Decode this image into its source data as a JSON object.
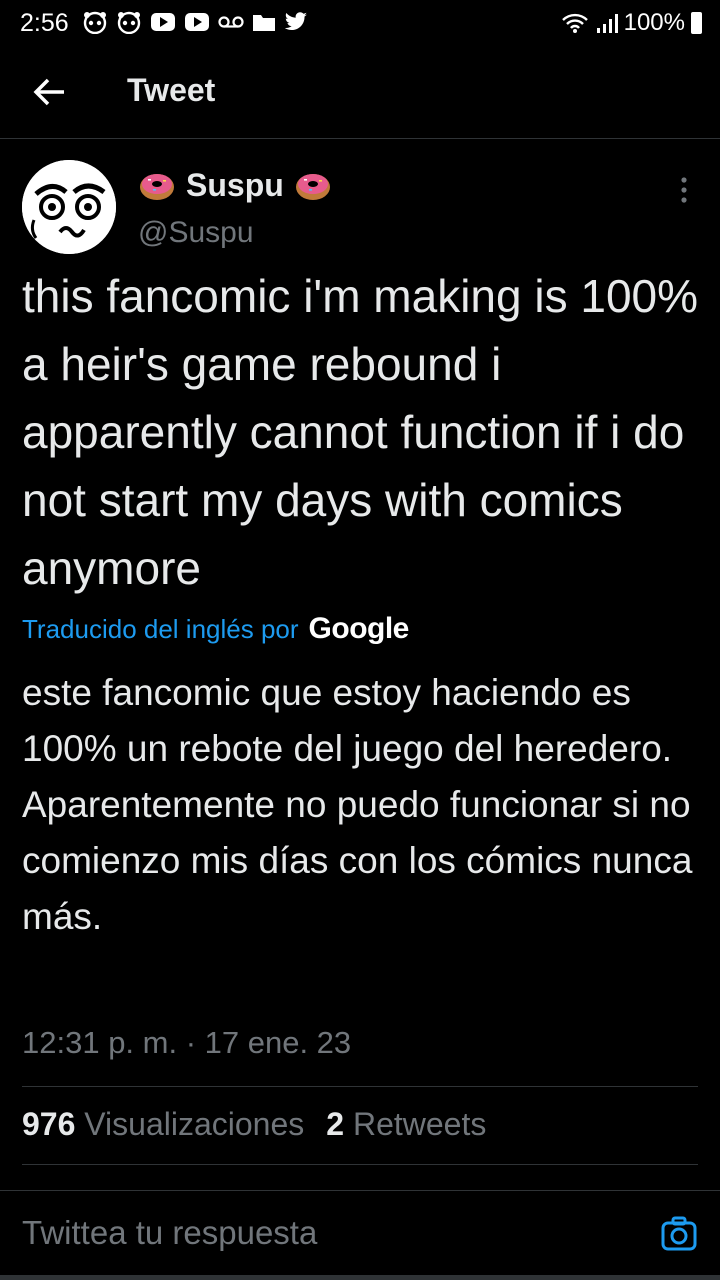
{
  "status_bar": {
    "time": "2:56",
    "battery": "100%",
    "icons": [
      "panda-icon",
      "panda-icon",
      "youtube-icon",
      "youtube-icon",
      "voicemail-icon",
      "folder-icon",
      "twitter-icon"
    ]
  },
  "header": {
    "title": "Tweet"
  },
  "tweet": {
    "display_name": "Suspu",
    "handle": "@Suspu",
    "text": "this fancomic i'm making is 100% a heir's game rebound i apparently cannot function if i do not start my days with comics anymore",
    "translated_label": "Traducido del inglés por",
    "translator": "Google",
    "translation": "este fancomic que estoy haciendo es 100% un rebote del juego del heredero. Aparentemente no puedo funcionar si no comienzo mis días con los cómics nunca más.",
    "timestamp": "12:31 p. m. · 17 ene. 23",
    "views_count": "976",
    "views_label": "Visualizaciones",
    "retweets_count": "2",
    "retweets_label": "Retweets"
  },
  "reply": {
    "placeholder": "Twittea tu respuesta"
  },
  "colors": {
    "accent": "#1d9bf0",
    "background": "#000000",
    "muted": "#71767b",
    "text": "#e7e9ea"
  }
}
